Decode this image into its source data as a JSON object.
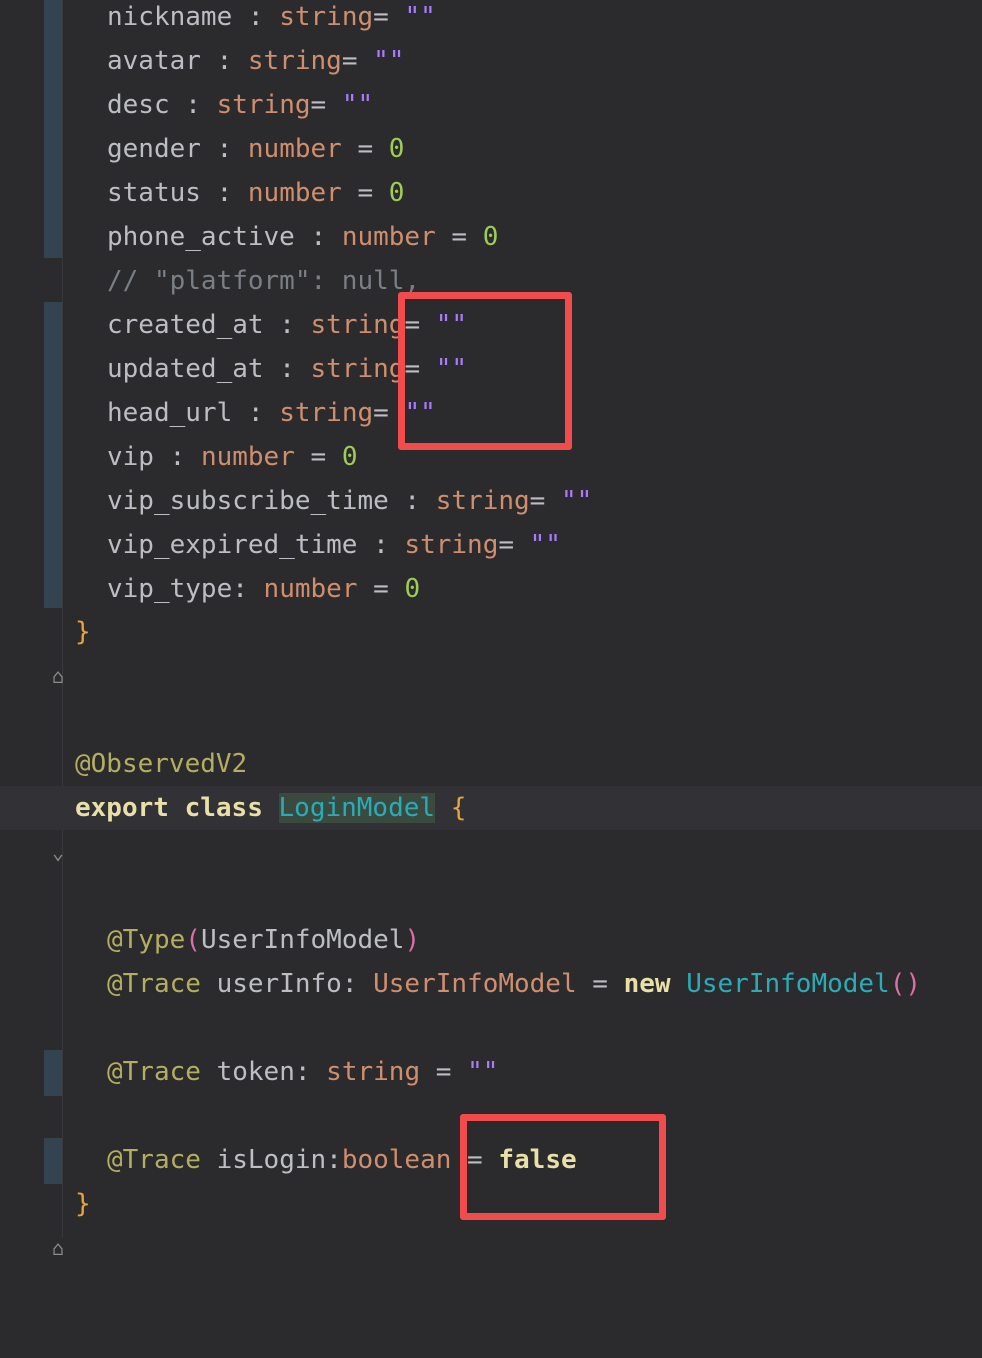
{
  "user_fields": [
    {
      "name": "nickname",
      "sep": " : ",
      "type": "string",
      "eq": "= ",
      "val": "\"\""
    },
    {
      "name": "avatar",
      "sep": " : ",
      "type": "string",
      "eq": "= ",
      "val": "\"\""
    },
    {
      "name": "desc",
      "sep": " : ",
      "type": "string",
      "eq": "= ",
      "val": "\"\""
    },
    {
      "name": "gender",
      "sep": " : ",
      "type": "number",
      "eq": " = ",
      "val": "0"
    },
    {
      "name": "status",
      "sep": " : ",
      "type": "number",
      "eq": " = ",
      "val": "0"
    },
    {
      "name": "phone_active",
      "sep": " : ",
      "type": "number",
      "eq": " = ",
      "val": "0"
    },
    {
      "comment": "// \"platform\": null,"
    },
    {
      "name": "created_at",
      "sep": " : ",
      "type": "string",
      "eq": "= ",
      "val": "\"\""
    },
    {
      "name": "updated_at",
      "sep": " : ",
      "type": "string",
      "eq": "= ",
      "val": "\"\""
    },
    {
      "name": "head_url",
      "sep": " : ",
      "type": "string",
      "eq": "= ",
      "val": "\"\""
    },
    {
      "name": "vip",
      "sep": " : ",
      "type": "number",
      "eq": " = ",
      "val": "0"
    },
    {
      "name": "vip_subscribe_time",
      "sep": " : ",
      "type": "string",
      "eq": "= ",
      "val": "\"\""
    },
    {
      "name": "vip_expired_time",
      "sep": " : ",
      "type": "string",
      "eq": "= ",
      "val": "\"\""
    },
    {
      "name": "vip_type",
      "sep": ": ",
      "type": "number",
      "eq": " = ",
      "val": "0"
    }
  ],
  "closing_brace_1": "}",
  "decorator_observed": "@ObservedV2",
  "export_kw": "export",
  "class_kw": "class",
  "class_name": "LoginModel",
  "open_brace": "{",
  "type_decorator": "@Type",
  "type_arg_open": "(",
  "type_arg": "UserInfoModel",
  "type_arg_close": ")",
  "trace": "@Trace",
  "userinfo_name": "userInfo",
  "userinfo_colon": ": ",
  "userinfo_type": "UserInfoModel",
  "userinfo_eq": " = ",
  "new_kw": "new",
  "userinfo_ctor": "UserInfoModel",
  "userinfo_parens": "()",
  "token_name": "token",
  "token_colon": ": ",
  "token_type": "string",
  "token_eq": " = ",
  "token_val": "\"\"",
  "islogin_name": "isLogin",
  "islogin_colon": ":",
  "islogin_type": "boolean",
  "islogin_eq": " = ",
  "islogin_val": "false",
  "closing_brace_2": "}",
  "colors": {
    "background": "#2b2b2d",
    "highlight_box": "#f24b4b",
    "type": "#cf8e6d",
    "string": "#a97bff",
    "number": "#9ecc57"
  }
}
